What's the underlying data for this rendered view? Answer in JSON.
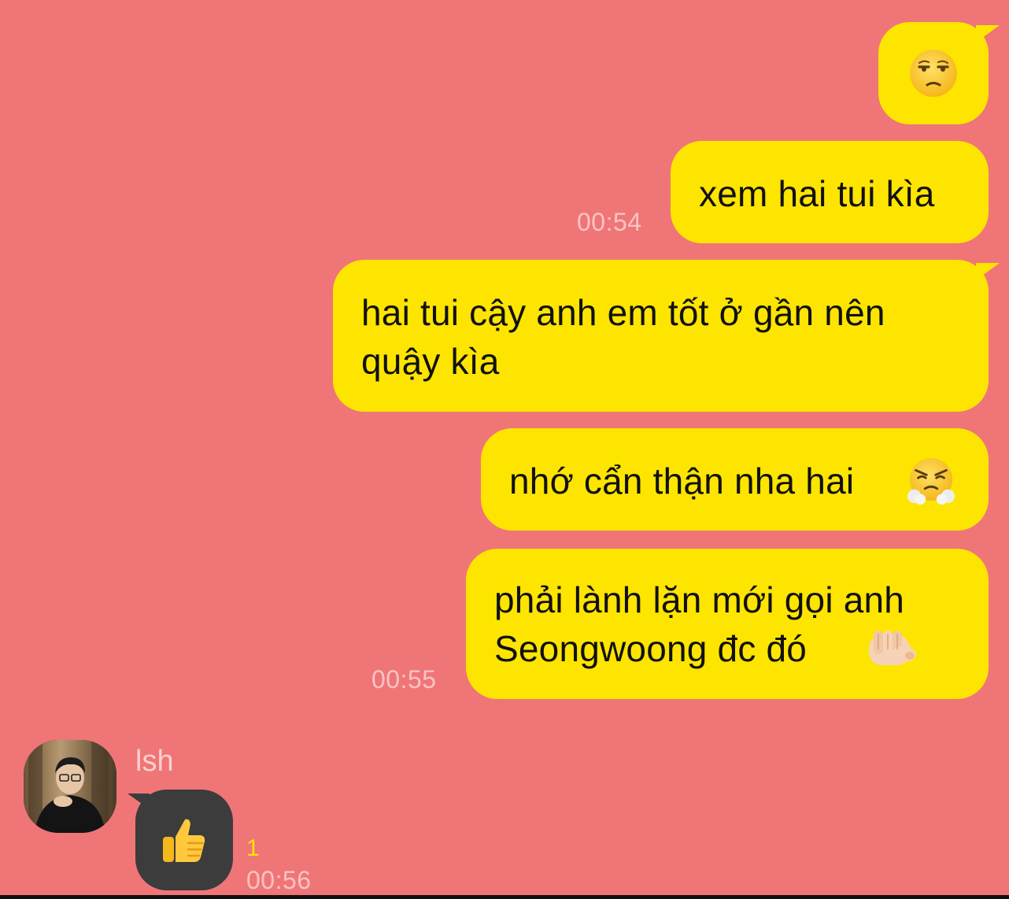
{
  "theme": {
    "background": "#F07577",
    "outgoing_bubble": "#FEE500",
    "incoming_bubble": "#3C3C3C",
    "timestamp_color": "#F9C4C2",
    "unread_color": "#FEE500"
  },
  "messages_out": [
    {
      "text": "",
      "emoji": "unamused-face"
    },
    {
      "text": "xem hai tui kìa",
      "time": "00:54"
    },
    {
      "line1": "hai tui cậy anh em tốt ở gần nên",
      "line2": "quậy kìa"
    },
    {
      "text": "nhớ cẩn thận nha hai",
      "emoji": "face-with-steam-from-nose"
    },
    {
      "line1": "phải lành lặn mới gọi anh",
      "line2": "Seongwoong đc đó",
      "emoji": "backhand-index-pointing-at-viewer",
      "time": "00:55"
    }
  ],
  "incoming": {
    "sender": "lsh",
    "emoji": "thumbs-up",
    "unread_count": "1",
    "time": "00:56"
  }
}
